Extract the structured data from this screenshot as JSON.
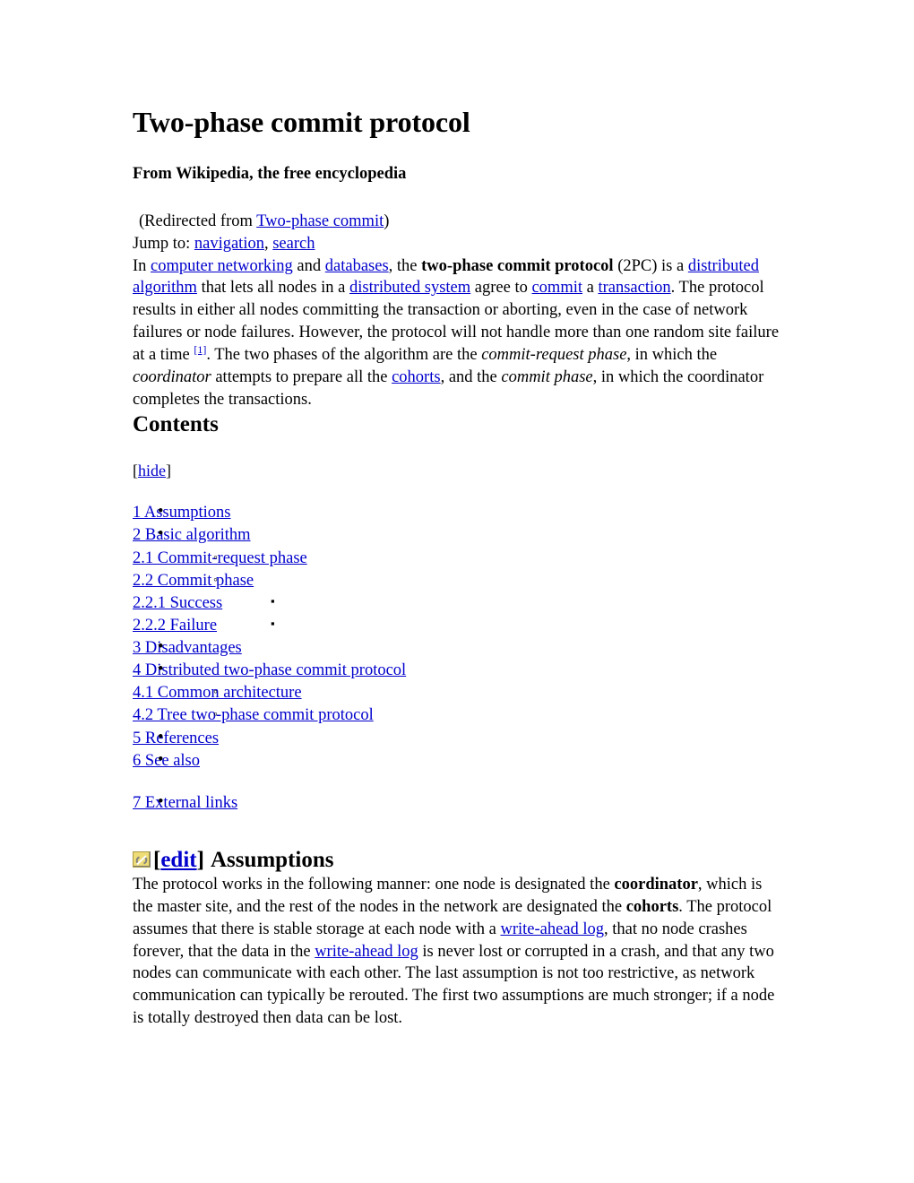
{
  "article": {
    "title": "Two-phase commit protocol",
    "tagline": "From Wikipedia, the free encyclopedia",
    "redirect": {
      "prefix": "(Redirected from ",
      "link": "Two-phase commit",
      "suffix": ")"
    },
    "jump": {
      "label": "Jump to: ",
      "nav_link": "navigation",
      "separator": ", ",
      "search_link": "search"
    }
  },
  "intro": {
    "t1": "In ",
    "l1": "computer networking",
    "t2": " and ",
    "l2": "databases",
    "t3": ", the ",
    "b1": "two-phase commit protocol",
    "t4": " (2PC) is a ",
    "l3": "distributed algorithm",
    "t5": " that lets all nodes in a ",
    "l4": "distributed system",
    "t6": " agree to ",
    "l5": "commit",
    "t7": " a ",
    "l6": "transaction",
    "t8": ". The protocol results in either all nodes committing the transaction or aborting, even in the case of network failures or node failures. However, the protocol will not handle more than one random site failure at a time ",
    "ref1": "[1]",
    "t9": ". The two phases of the algorithm are the ",
    "i1": "commit-request phase",
    "t10": ", in which the ",
    "i2": "coordinator",
    "t11": " attempts to prepare all the ",
    "l7": "cohorts",
    "t12": ", and the ",
    "i3": "commit phase",
    "t13": ", in which the coordinator completes the transactions."
  },
  "contents": {
    "heading": "Contents",
    "hide_open": "[",
    "hide_label": "hide",
    "hide_close": "]",
    "items": [
      {
        "level": 1,
        "label": "1 Assumptions",
        "bullet": "disc"
      },
      {
        "level": 1,
        "label": "2 Basic algorithm",
        "bullet": "disc"
      },
      {
        "level": 2,
        "label": "2.1 Commit-request phase",
        "bullet": "circle"
      },
      {
        "level": 2,
        "label": "2.2 Commit phase",
        "bullet": "circle"
      },
      {
        "level": 3,
        "label": "2.2.1 Success",
        "bullet": "square"
      },
      {
        "level": 3,
        "label": "2.2.2 Failure",
        "bullet": "square"
      },
      {
        "level": 1,
        "label": "3 Disadvantages",
        "bullet": "disc"
      },
      {
        "level": 1,
        "label": "4 Distributed two-phase commit protocol",
        "bullet": "disc"
      },
      {
        "level": 2,
        "label": "4.1 Common architecture",
        "bullet": "circle"
      },
      {
        "level": 2,
        "label": "4.2 Tree two-phase commit protocol",
        "bullet": "circle"
      },
      {
        "level": 1,
        "label": "5 References",
        "bullet": "disc"
      },
      {
        "level": 1,
        "label": "6 See also",
        "bullet": "disc"
      },
      {
        "level": 1,
        "label": "7 External links",
        "bullet": "disc",
        "gap_before": true
      }
    ]
  },
  "assumptions": {
    "icon_name": "broken-image-icon",
    "bracket_open": "[",
    "edit_label": "edit",
    "bracket_close": "]",
    "heading": "Assumptions",
    "t1": "The protocol works in the following manner: one node is designated the ",
    "b1": "coordinator",
    "t2": ", which is the master site, and the rest of the nodes in the network are designated the ",
    "b2": "cohorts",
    "t3": ". The protocol assumes that there is stable storage at each node with a ",
    "l1": "write-ahead log",
    "t4": ", that no node crashes forever, that the data in the ",
    "l2": "write-ahead log",
    "t5": " is never lost or corrupted in a crash, and that any two nodes can communicate with each other. The last assumption is not too restrictive, as network communication can typically be rerouted. The first two assumptions are much stronger; if a node is totally destroyed then data can be lost."
  },
  "colors": {
    "link": "#0000cc",
    "text": "#000000",
    "icon_background": "#eedd77",
    "icon_chain": "#888888",
    "page_background": "#ffffff"
  },
  "bullets": {
    "disc": "•",
    "circle": "◦",
    "square": "▪"
  }
}
